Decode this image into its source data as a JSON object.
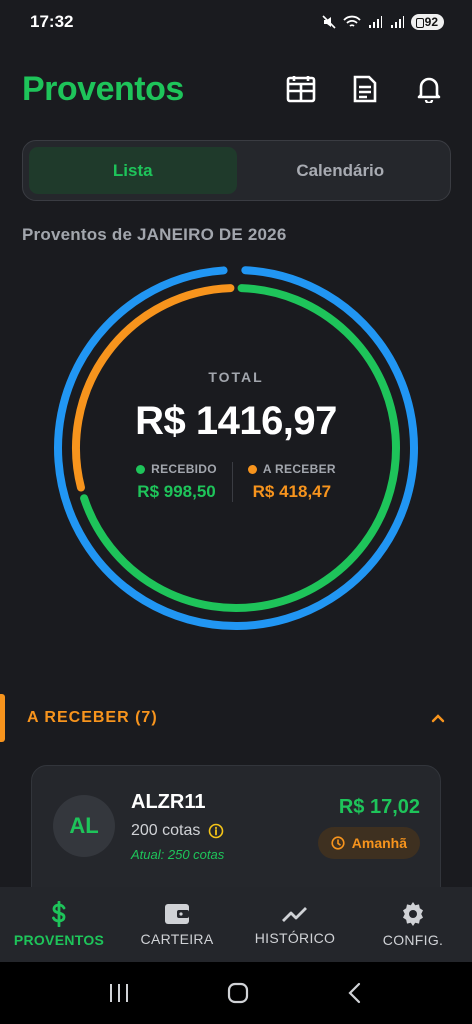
{
  "status_bar": {
    "time": "17:32",
    "battery": "92",
    "icons": [
      "mute-icon",
      "wifi-icon",
      "signal-icon",
      "signal-icon",
      "battery-icon"
    ]
  },
  "header": {
    "title": "Proventos",
    "actions": [
      "calendar-view-icon",
      "document-icon",
      "bell-icon"
    ]
  },
  "tabs": [
    {
      "label": "Lista",
      "active": true
    },
    {
      "label": "Calendário",
      "active": false
    }
  ],
  "period_label": "Proventos de JANEIRO DE 2026",
  "summary": {
    "total_label": "TOTAL",
    "total_value": "R$ 1416,97",
    "received_label": "RECEBIDO",
    "received_value": "R$ 998,50",
    "pending_label": "A RECEBER",
    "pending_value": "R$ 418,47",
    "colors": {
      "received": "#1ec45a",
      "pending": "#f7941d",
      "outer": "#2196f3"
    },
    "received_fraction": 0.7047,
    "pending_fraction": 0.2953
  },
  "section": {
    "title": "A RECEBER (7)",
    "icon": "chevron-up-icon"
  },
  "cards": [
    {
      "avatar": "AL",
      "ticker": "ALZR11",
      "shares": "200 cotas",
      "current": "Atual: 250 cotas",
      "amount": "R$ 17,02",
      "badge": "Amanhã"
    }
  ],
  "bottom_nav": [
    {
      "label": "PROVENTOS",
      "icon": "dollar-icon",
      "active": true
    },
    {
      "label": "CARTEIRA",
      "icon": "wallet-icon",
      "active": false
    },
    {
      "label": "HISTÓRICO",
      "icon": "trend-icon",
      "active": false
    },
    {
      "label": "CONFIG.",
      "icon": "gear-icon",
      "active": false
    }
  ],
  "system_nav": [
    "recents-icon",
    "home-icon",
    "back-icon"
  ]
}
